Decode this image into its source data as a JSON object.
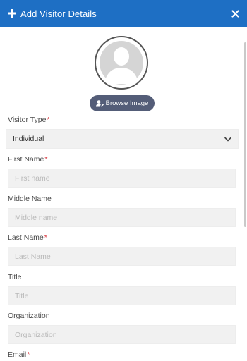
{
  "header": {
    "title": "Add Visitor Details"
  },
  "photo": {
    "browse_label": "Browse Image"
  },
  "form": {
    "visitor_type": {
      "label": "Visitor Type",
      "required": "*",
      "value": "Individual"
    },
    "first_name": {
      "label": "First Name",
      "required": "*",
      "placeholder": "First name"
    },
    "middle_name": {
      "label": "Middle Name",
      "placeholder": "Middle name"
    },
    "last_name": {
      "label": "Last Name",
      "required": "*",
      "placeholder": "Last Name"
    },
    "title": {
      "label": "Title",
      "placeholder": "Title"
    },
    "organization": {
      "label": "Organization",
      "placeholder": "Organization"
    },
    "email": {
      "label": "Email",
      "required": "*"
    }
  },
  "colors": {
    "header": "#1e6fc4",
    "button": "#545d78",
    "required": "#d9363e"
  }
}
